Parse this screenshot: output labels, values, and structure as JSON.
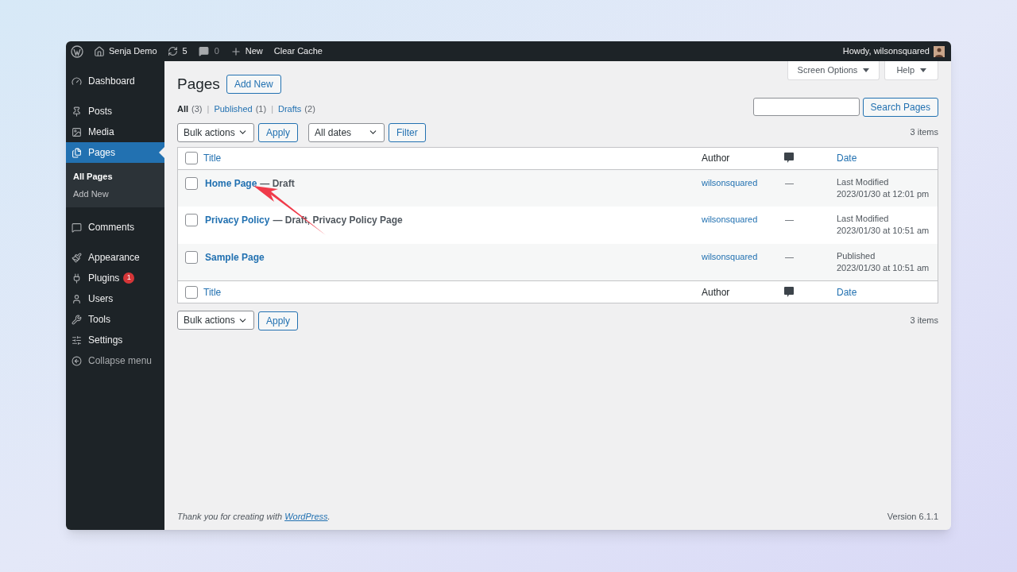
{
  "admin_bar": {
    "site": "Senja Demo",
    "updates": "5",
    "comments": "0",
    "new": "New",
    "clear_cache": "Clear Cache",
    "howdy": "Howdy, wilsonsquared"
  },
  "sidebar": {
    "items": [
      {
        "label": "Dashboard",
        "selected": false
      },
      {
        "label": "Posts",
        "selected": false
      },
      {
        "label": "Media",
        "selected": false
      },
      {
        "label": "Pages",
        "selected": true,
        "children": [
          {
            "label": "All Pages",
            "selected": true
          },
          {
            "label": "Add New",
            "selected": false
          }
        ]
      },
      {
        "label": "Comments",
        "selected": false
      },
      {
        "label": "Appearance",
        "selected": false
      },
      {
        "label": "Plugins",
        "selected": false,
        "badge": "1"
      },
      {
        "label": "Users",
        "selected": false
      },
      {
        "label": "Tools",
        "selected": false
      },
      {
        "label": "Settings",
        "selected": false
      },
      {
        "label": "Collapse menu",
        "selected": false
      }
    ]
  },
  "header": {
    "title": "Pages",
    "add_new": "Add New",
    "screen_options": "Screen Options",
    "help": "Help"
  },
  "filters": [
    {
      "label": "All",
      "count": "(3)",
      "selected": true
    },
    {
      "separator": "|",
      "label": "Published",
      "count": "(1)",
      "selected": false
    },
    {
      "separator": "|",
      "label": "Drafts",
      "count": "(2)",
      "selected": false
    }
  ],
  "search_button": "Search Pages",
  "top_actions": {
    "bulk": "Bulk actions",
    "apply": "Apply",
    "dates": "All dates",
    "filter": "Filter",
    "count": "3 items"
  },
  "table": {
    "columns": [
      "Title",
      "Author",
      "Date"
    ],
    "header_checked": false,
    "footer_checked": false,
    "rows": [
      {
        "title": "Home Page",
        "state": "— Draft",
        "author": "wilsonsquared",
        "comments": "—",
        "date_status": "Last Modified",
        "date": "2023/01/30 at 12:01 pm",
        "checked": false
      },
      {
        "title": "Privacy Policy",
        "state": "— Draft, Privacy Policy Page",
        "author": "wilsonsquared",
        "comments": "—",
        "date_status": "Last Modified",
        "date": "2023/01/30 at 10:51 am",
        "checked": false
      },
      {
        "title": "Sample Page",
        "author": "wilsonsquared",
        "comments": "—",
        "date_status": "Published",
        "date": "2023/01/30 at 10:51 am",
        "checked": false
      }
    ],
    "footer_columns": [
      "Title",
      "Author",
      "Date"
    ]
  },
  "bottom_actions": {
    "bulk": "Bulk actions",
    "apply": "Apply",
    "count": "3 items"
  },
  "footer": {
    "text": "Thank you for creating with ",
    "link": "WordPress",
    "tail": ".",
    "version": "Version 6.1.1"
  }
}
